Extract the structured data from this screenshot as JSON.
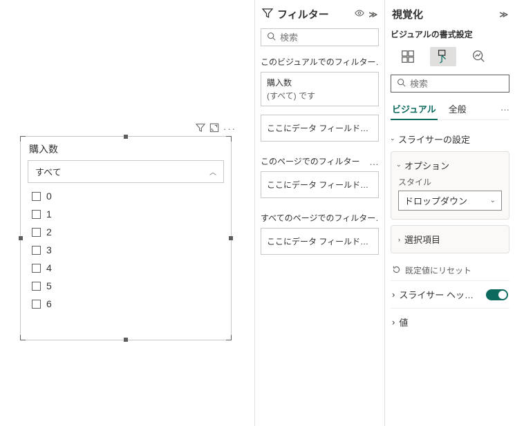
{
  "filters": {
    "title": "フィルター",
    "search_placeholder": "検索",
    "sections": {
      "visual": {
        "label": "このビジュアルでのフィルター…",
        "card": {
          "field": "購入数",
          "status": "(すべて) です"
        },
        "dropzone": "ここにデータ フィールド…"
      },
      "page": {
        "label": "このページでのフィルター",
        "dropzone": "ここにデータ フィールド…"
      },
      "all": {
        "label": "すべてのページでのフィルター…",
        "dropzone": "ここにデータ フィールド…"
      }
    }
  },
  "viz": {
    "title": "視覚化",
    "subtitle": "ビジュアルの書式設定",
    "search_placeholder": "検索",
    "tabs": {
      "visual": "ビジュアル",
      "general": "全般"
    },
    "slicer_settings": "スライサーの設定",
    "option_card": {
      "title": "オプション",
      "style_label": "スタイル",
      "style_value": "ドロップダウン"
    },
    "selection": "選択項目",
    "reset": "既定値にリセット",
    "slicer_header": "スライサー ヘッ…",
    "values": "値"
  },
  "slicer": {
    "title": "購入数",
    "selected": "すべて",
    "items": [
      "0",
      "1",
      "2",
      "3",
      "4",
      "5",
      "6"
    ]
  }
}
